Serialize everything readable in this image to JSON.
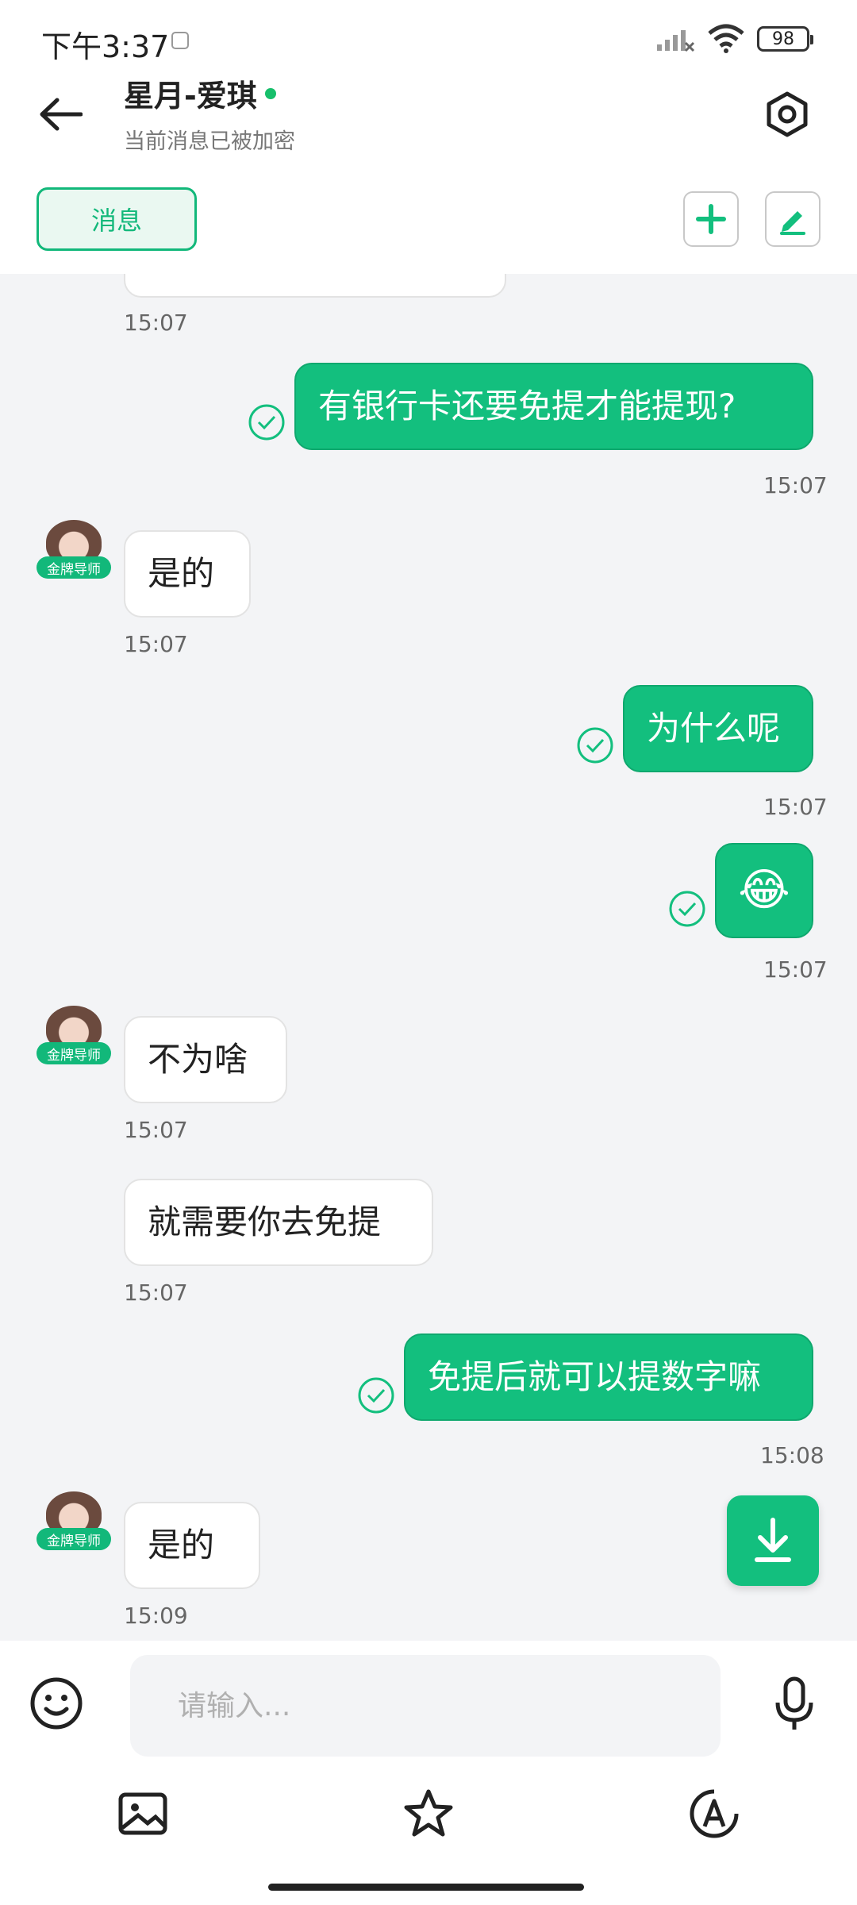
{
  "status_bar": {
    "time": "下午3:37",
    "battery": "98"
  },
  "header": {
    "title": "星月-爱琪",
    "subtitle": "当前消息已被加密"
  },
  "tabs": {
    "messages": "消息"
  },
  "avatar_badge": "金牌导师",
  "messages": [
    {
      "side": "in",
      "text": "",
      "time": "15:07"
    },
    {
      "side": "out",
      "text": "有银行卡还要免提才能提现?",
      "time": "15:07"
    },
    {
      "side": "in",
      "text": "是的",
      "time": "15:07"
    },
    {
      "side": "out",
      "text": "为什么呢",
      "time": "15:07"
    },
    {
      "side": "out",
      "text": "😂",
      "time": "15:07"
    },
    {
      "side": "in",
      "text": "不为啥",
      "time": "15:07"
    },
    {
      "side": "in",
      "text": "就需要你去免提",
      "time": "15:07"
    },
    {
      "side": "out",
      "text": "免提后就可以提数字嘛",
      "time": "15:08"
    },
    {
      "side": "in",
      "text": "是的",
      "time": "15:09"
    }
  ],
  "input": {
    "placeholder": "请输入..."
  },
  "colors": {
    "accent": "#13bf7e",
    "online": "#17bf6b",
    "chat_bg": "#f3f4f6"
  },
  "icons": [
    "back-arrow-icon",
    "settings-hexagon-icon",
    "plus-icon",
    "pen-icon",
    "check-circle-icon",
    "download-icon",
    "emoji-icon",
    "mic-icon",
    "image-icon",
    "star-icon",
    "text-style-icon"
  ]
}
